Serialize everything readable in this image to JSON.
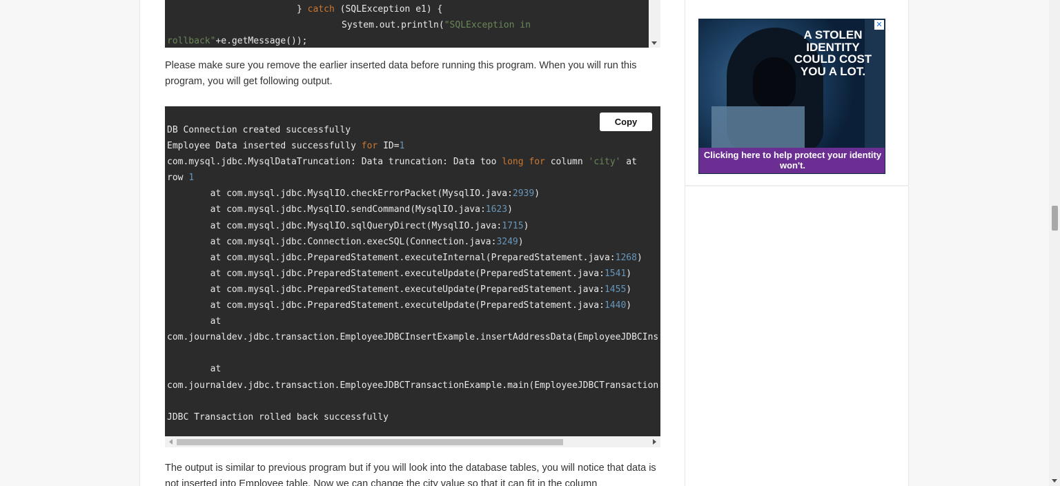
{
  "article": {
    "code_top": {
      "line1_a": "} ",
      "line1_kw": "catch",
      "line1_b": " (SQLException e1) {",
      "line2_a": "System.out.println(",
      "line2_str": "\"SQLException in",
      "line3_str": "rollback\"",
      "line3_b": "+e.getMessage());"
    },
    "para1": "Please make sure you remove the earlier inserted data before running this program. When you will run this program, you will get following output.",
    "output": {
      "copy_label": "Copy",
      "lines": [
        [
          {
            "t": "DB Connection created successfully"
          }
        ],
        [
          {
            "t": "Employee Data inserted successfully "
          },
          {
            "t": "for",
            "c": "kw"
          },
          {
            "t": " ID="
          },
          {
            "t": "1",
            "c": "num"
          }
        ],
        [
          {
            "t": "com.mysql.jdbc.MysqlDataTruncation: Data truncation: Data too "
          },
          {
            "t": "long",
            "c": "kw"
          },
          {
            "t": " "
          },
          {
            "t": "for",
            "c": "kw"
          },
          {
            "t": " column "
          },
          {
            "t": "'city'",
            "c": "str"
          },
          {
            "t": " at"
          }
        ],
        [
          {
            "t": "row "
          },
          {
            "t": "1",
            "c": "num"
          }
        ],
        [
          {
            "t": "\tat com.mysql.jdbc.MysqlIO.checkErrorPacket(MysqlIO.java:"
          },
          {
            "t": "2939",
            "c": "num"
          },
          {
            "t": ")"
          }
        ],
        [
          {
            "t": "\tat com.mysql.jdbc.MysqlIO.sendCommand(MysqlIO.java:"
          },
          {
            "t": "1623",
            "c": "num"
          },
          {
            "t": ")"
          }
        ],
        [
          {
            "t": "\tat com.mysql.jdbc.MysqlIO.sqlQueryDirect(MysqlIO.java:"
          },
          {
            "t": "1715",
            "c": "num"
          },
          {
            "t": ")"
          }
        ],
        [
          {
            "t": "\tat com.mysql.jdbc.Connection.execSQL(Connection.java:"
          },
          {
            "t": "3249",
            "c": "num"
          },
          {
            "t": ")"
          }
        ],
        [
          {
            "t": "\tat com.mysql.jdbc.PreparedStatement.executeInternal(PreparedStatement.java:"
          },
          {
            "t": "1268",
            "c": "num"
          },
          {
            "t": ")"
          }
        ],
        [
          {
            "t": "\tat com.mysql.jdbc.PreparedStatement.executeUpdate(PreparedStatement.java:"
          },
          {
            "t": "1541",
            "c": "num"
          },
          {
            "t": ")"
          }
        ],
        [
          {
            "t": "\tat com.mysql.jdbc.PreparedStatement.executeUpdate(PreparedStatement.java:"
          },
          {
            "t": "1455",
            "c": "num"
          },
          {
            "t": ")"
          }
        ],
        [
          {
            "t": "\tat com.mysql.jdbc.PreparedStatement.executeUpdate(PreparedStatement.java:"
          },
          {
            "t": "1440",
            "c": "num"
          },
          {
            "t": ")"
          }
        ],
        [
          {
            "t": "\tat"
          }
        ],
        [
          {
            "t": "com.journaldev.jdbc.transaction.EmployeeJDBCInsertExample.insertAddressData(EmployeeJDBCIns"
          }
        ],
        [
          {
            "t": ""
          }
        ],
        [
          {
            "t": "\tat"
          }
        ],
        [
          {
            "t": "com.journaldev.jdbc.transaction.EmployeeJDBCTransactionExample.main(EmployeeJDBCTransaction"
          }
        ],
        [
          {
            "t": ""
          }
        ],
        [
          {
            "t": "JDBC Transaction rolled back successfully"
          }
        ]
      ]
    },
    "para2": "The output is similar to previous program but if you will look into the database tables, you will notice that data is not inserted into Employee table. Now we can change the city value so that it can fit in the column"
  },
  "sidebar": {
    "ad": {
      "headline": "A STOLEN IDENTITY COULD COST YOU A LOT.",
      "tagline": "Clicking here to help protect your identity won't.",
      "close_icon": "close-icon"
    }
  },
  "colors": {
    "code_bg": "#2b2b2b",
    "keyword": "#cc7832",
    "string": "#6a8759",
    "number": "#6897bb",
    "ad_strip": "#6b2f93"
  }
}
